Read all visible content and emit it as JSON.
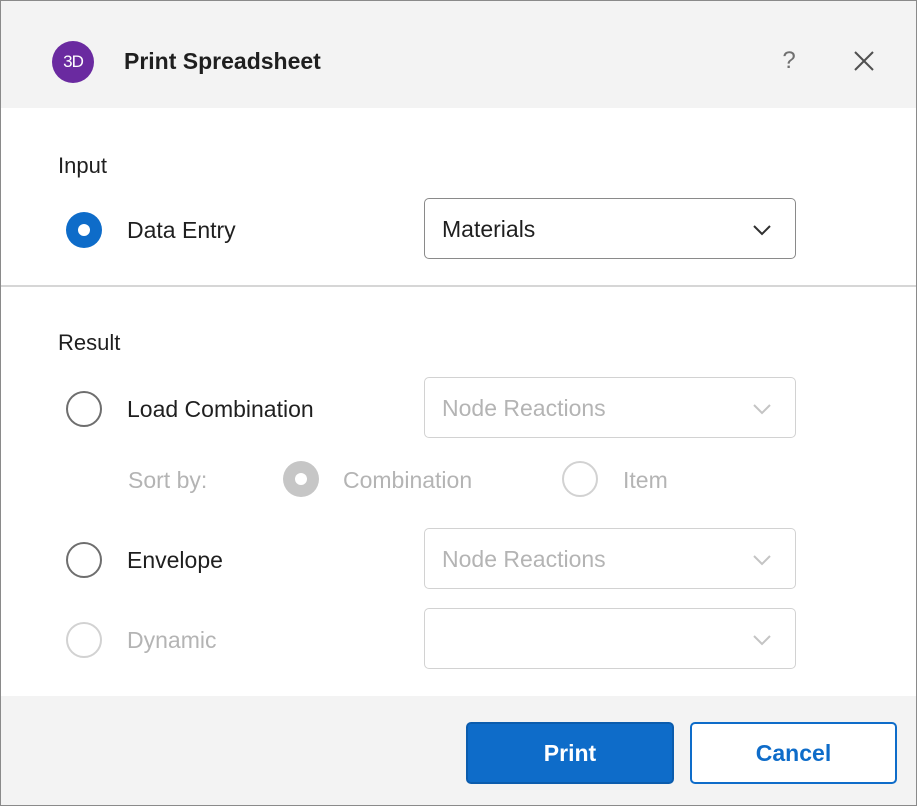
{
  "window": {
    "title": "Print Spreadsheet",
    "logo_text": "3D",
    "help_label": "?",
    "icons": [
      "app-logo-icon",
      "help-icon",
      "close-icon",
      "chevron-down-icon"
    ]
  },
  "input": {
    "heading": "Input",
    "data_entry": {
      "label": "Data Entry",
      "selected": true,
      "value": "Materials"
    }
  },
  "result": {
    "heading": "Result",
    "load_combination": {
      "label": "Load Combination",
      "selected": false,
      "value": "Node Reactions",
      "enabled": false
    },
    "sort": {
      "label": "Sort by:",
      "options": [
        {
          "label": "Combination",
          "selected": true
        },
        {
          "label": "Item",
          "selected": false
        }
      ]
    },
    "envelope": {
      "label": "Envelope",
      "selected": false,
      "value": "Node Reactions",
      "enabled": false
    },
    "dynamic": {
      "label": "Dynamic",
      "selected": false,
      "value": "",
      "enabled": false
    }
  },
  "footer": {
    "print_label": "Print",
    "cancel_label": "Cancel"
  },
  "colors": {
    "accent": "#0e6cc9",
    "logo": "#6a2aa0",
    "titlebar_bg": "#f3f3f3",
    "disabled_text": "#b4b4b4"
  }
}
